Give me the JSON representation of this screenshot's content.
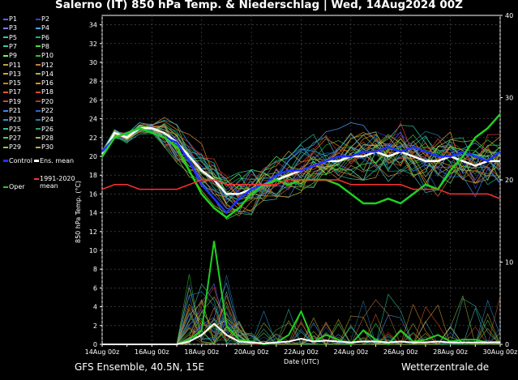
{
  "title": "Salerno  (IT)  850 hPa Temp. & Niederschlag | Wed, 14Aug2024 00Z",
  "footer_left": "GFS Ensemble, 40.5N, 15E",
  "footer_right": "Wetterzentrale.de",
  "legend": {
    "members": [
      {
        "label": "P1",
        "color": "#6060ff"
      },
      {
        "label": "P2",
        "color": "#4040c0"
      },
      {
        "label": "P3",
        "color": "#8080ff"
      },
      {
        "label": "P4",
        "color": "#50a0ff"
      },
      {
        "label": "P5",
        "color": "#40c0c0"
      },
      {
        "label": "P6",
        "color": "#20b080"
      },
      {
        "label": "P7",
        "color": "#30d0a0"
      },
      {
        "label": "P8",
        "color": "#40e040"
      },
      {
        "label": "P9",
        "color": "#60ff60"
      },
      {
        "label": "P10",
        "color": "#30c030"
      },
      {
        "label": "P11",
        "color": "#c0a040"
      },
      {
        "label": "P12",
        "color": "#c08040"
      },
      {
        "label": "P13",
        "color": "#e0a030"
      },
      {
        "label": "P14",
        "color": "#b0b040"
      },
      {
        "label": "P15",
        "color": "#d08020"
      },
      {
        "label": "P16",
        "color": "#e09020"
      },
      {
        "label": "P17",
        "color": "#e06020"
      },
      {
        "label": "P18",
        "color": "#d05030"
      },
      {
        "label": "P19",
        "color": "#e04040"
      },
      {
        "label": "P20",
        "color": "#c03030"
      },
      {
        "label": "P21",
        "color": "#4080ff"
      },
      {
        "label": "P22",
        "color": "#3060d0"
      },
      {
        "label": "P23",
        "color": "#20a0e0"
      },
      {
        "label": "P24",
        "color": "#2080b0"
      },
      {
        "label": "P25",
        "color": "#30c0a0"
      },
      {
        "label": "P26",
        "color": "#20a070"
      },
      {
        "label": "P27",
        "color": "#50d050"
      },
      {
        "label": "P28",
        "color": "#a0c040"
      },
      {
        "label": "P29",
        "color": "#90d030"
      },
      {
        "label": "P30",
        "color": "#c0b030"
      }
    ],
    "control": {
      "label": "Control",
      "color": "#2030ff"
    },
    "ens_mean": {
      "label": "Ens. mean",
      "color": "#ffffff"
    },
    "clim": {
      "label": "1991-2020\nmean",
      "line1": "1991-2020",
      "line2": "mean",
      "color": "#ff3030"
    },
    "oper": {
      "label": "Oper",
      "color": "#20d020"
    }
  },
  "chart_data": {
    "type": "line",
    "ylabel": "850 hPa Temp. (°C)",
    "xlabel": "Date (UTC)",
    "ylim": [
      0,
      35
    ],
    "y2lim": [
      0,
      40
    ],
    "yticks": [
      0,
      2,
      4,
      6,
      8,
      10,
      12,
      14,
      16,
      18,
      20,
      22,
      24,
      26,
      28,
      30,
      32,
      34
    ],
    "y2ticks": [
      0,
      10,
      20,
      30,
      40
    ],
    "xticks": [
      "14Aug 00z",
      "16Aug 00z",
      "18Aug 00z",
      "20Aug 00z",
      "22Aug 00z",
      "24Aug 00z",
      "26Aug 00z",
      "28Aug 00z",
      "30Aug 00z"
    ],
    "grid": true,
    "x_days": [
      0,
      0.5,
      1,
      1.5,
      2,
      2.5,
      3,
      3.5,
      4,
      4.5,
      5,
      5.5,
      6,
      6.5,
      7,
      7.5,
      8,
      8.5,
      9,
      9.5,
      10,
      10.5,
      11,
      11.5,
      12,
      12.5,
      13,
      13.5,
      14,
      14.5,
      15,
      15.5,
      16
    ],
    "series": [
      {
        "name": "Ens. mean",
        "color": "#ffffff",
        "values": [
          20.2,
          22.5,
          22.0,
          23.0,
          23.0,
          22.5,
          21.5,
          20.0,
          18.5,
          17.5,
          16.0,
          16.0,
          16.5,
          17.0,
          17.5,
          18.0,
          18.5,
          19.0,
          19.5,
          19.5,
          20.0,
          20.0,
          20.5,
          20.0,
          20.5,
          20.0,
          19.5,
          19.5,
          20.0,
          19.5,
          19.0,
          19.5,
          19.5
        ]
      },
      {
        "name": "Control",
        "color": "#2030ff",
        "values": [
          20.5,
          22.0,
          22.5,
          23.0,
          22.5,
          22.0,
          21.5,
          19.5,
          17.0,
          15.5,
          14.0,
          15.5,
          16.5,
          17.0,
          18.0,
          18.5,
          18.5,
          19.0,
          19.5,
          20.0,
          20.0,
          20.5,
          20.5,
          21.0,
          20.5,
          21.0,
          20.5,
          20.0,
          20.0,
          20.5,
          20.0,
          19.5,
          20.5
        ]
      },
      {
        "name": "Oper",
        "color": "#20d020",
        "values": [
          20.0,
          22.0,
          22.5,
          23.0,
          22.5,
          22.0,
          21.0,
          18.5,
          16.0,
          14.5,
          13.5,
          14.5,
          16.0,
          17.0,
          17.5,
          17.0,
          17.5,
          17.5,
          17.5,
          17.0,
          16.0,
          15.0,
          15.0,
          15.5,
          15.0,
          16.0,
          17.0,
          16.5,
          18.5,
          20.0,
          22.0,
          23.0,
          24.5
        ]
      },
      {
        "name": "1991-2020 mean",
        "color": "#ff3030",
        "values": [
          16.5,
          17.0,
          17.0,
          16.5,
          16.5,
          16.5,
          16.5,
          17.0,
          17.5,
          17.5,
          17.0,
          17.0,
          17.0,
          17.0,
          17.0,
          17.5,
          17.5,
          17.5,
          17.5,
          17.5,
          17.0,
          17.0,
          17.0,
          17.0,
          17.0,
          16.5,
          16.5,
          16.5,
          16.0,
          16.0,
          16.0,
          16.0,
          15.5
        ]
      },
      {
        "name": "Precip Oper",
        "color": "#20d020",
        "values": [
          0,
          0,
          0,
          0,
          0,
          0,
          0,
          0.5,
          1.5,
          11.0,
          2.0,
          0.5,
          0.3,
          0,
          0.2,
          1.0,
          3.5,
          0.3,
          1.0,
          0.5,
          0,
          1.5,
          0.5,
          0,
          1.5,
          0.3,
          0.5,
          1.0,
          0.3,
          0.5,
          0.5,
          0.2,
          0.3
        ]
      },
      {
        "name": "Precip mean",
        "color": "#ffffff",
        "values": [
          0,
          0,
          0,
          0,
          0,
          0,
          0,
          0.3,
          1.0,
          2.2,
          1.0,
          0.3,
          0.2,
          0.1,
          0.2,
          0.3,
          0.6,
          0.3,
          0.4,
          0.3,
          0.2,
          0.3,
          0.3,
          0.2,
          0.3,
          0.2,
          0.2,
          0.3,
          0.2,
          0.2,
          0.2,
          0.2,
          0.2
        ]
      }
    ],
    "annotations": {
      "max_precip_spikes": [
        11.5,
        10.0,
        12.2,
        7.8,
        7.3,
        6.5,
        5.0
      ]
    }
  }
}
